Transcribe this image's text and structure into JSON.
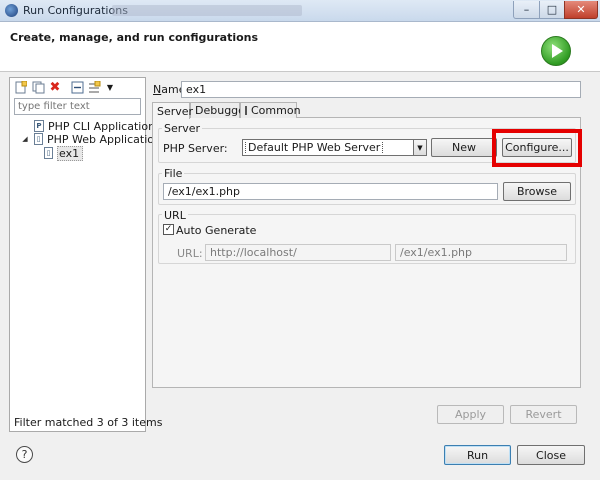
{
  "window": {
    "title": "Run Configurations"
  },
  "header": {
    "title": "Create, manage, and run configurations"
  },
  "left": {
    "filter_placeholder": "type filter text",
    "tree": [
      {
        "label": "PHP CLI Application",
        "icon": "P"
      },
      {
        "label": "PHP Web Application",
        "icon": "▯"
      },
      {
        "label": "ex1",
        "icon": "▯"
      }
    ],
    "status": "Filter matched 3 of 3 items"
  },
  "config": {
    "name_label": "Name:",
    "name_value": "ex1",
    "tabs": [
      "Server",
      "Debugger",
      "Common"
    ],
    "server_group": "Server",
    "php_server_label": "PHP Server:",
    "php_server_value": "Default PHP Web Server",
    "new_button": "New",
    "configure_button": "Configure...",
    "file_group": "File",
    "file_value": "/ex1/ex1.php",
    "browse_button": "Browse",
    "url_group": "URL",
    "auto_generate_label": "Auto Generate",
    "url_label": "URL:",
    "url_base": "http://localhost/",
    "url_path": "/ex1/ex1.php",
    "apply_button": "Apply",
    "revert_button": "Revert"
  },
  "footer": {
    "run_button": "Run",
    "close_button": "Close"
  },
  "colors": {
    "highlight": "#e50000",
    "run_badge": "#2f9b22"
  },
  "icons": {
    "app": "eclipse-icon",
    "run": "run-icon",
    "help": "help-icon"
  }
}
